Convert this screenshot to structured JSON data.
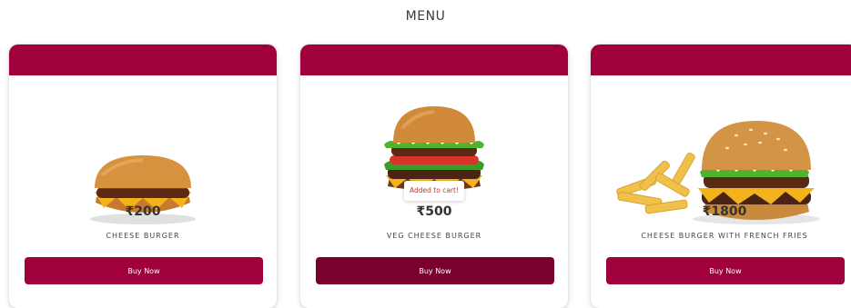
{
  "menu": {
    "title": "MENU"
  },
  "products": [
    {
      "price": "₹200",
      "name": "CHEESE BURGER",
      "button_label": "Buy Now",
      "image": "cheese-burger"
    },
    {
      "price": "₹500",
      "name": "VEG CHEESE BURGER",
      "button_label": "Buy Now",
      "image": "veg-cheese-burger"
    },
    {
      "price": "₹1800",
      "name": "CHEESE BURGER WITH FRENCH FRIES",
      "button_label": "Buy Now",
      "image": "cheese-burger-with-fries"
    }
  ],
  "toast": {
    "message": "Added to cart!"
  },
  "colors": {
    "brand": "#a0003c",
    "button_pressed": "#7a002e",
    "toast_text": "#c0392b"
  }
}
